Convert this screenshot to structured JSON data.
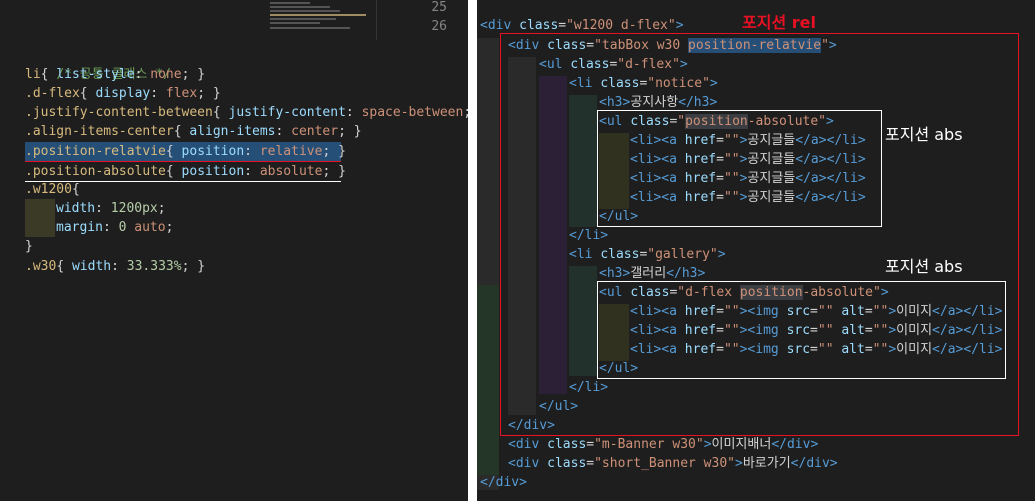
{
  "editor_left": {
    "line_numbers": [
      "25",
      "26"
    ],
    "comment": "/* 공통 클래스 */",
    "rules": [
      {
        "selector": "li",
        "property": "list-style",
        "value": "none"
      },
      {
        "selector": ".d-flex",
        "property": "display",
        "value": "flex"
      },
      {
        "selector": ".justify-content-between",
        "property": "justify-content",
        "value": "space-between"
      },
      {
        "selector": ".align-items-center",
        "property": "align-items",
        "value": "center"
      },
      {
        "selector": ".position-relatvie",
        "property": "position",
        "value": "relative"
      },
      {
        "selector": ".position-absolute",
        "property": "position",
        "value": "absolute"
      }
    ],
    "w1200": {
      "selector": ".w1200",
      "width_prop": "width",
      "width_val": "1200px",
      "margin_prop": "margin",
      "margin_val_num": "0",
      "margin_val_rest": "auto"
    },
    "w30": {
      "selector": ".w30",
      "property": "width",
      "value": "33.333%"
    }
  },
  "editor_right": {
    "div_w1200": {
      "tag": "div",
      "attr": "class",
      "value": "\"w1200 d-flex\""
    },
    "div_tabbox": {
      "tag": "div",
      "attr": "class",
      "value_prefix": "\"tabBox w30 ",
      "value_hl": "position-relatvie",
      "value_suffix": "\""
    },
    "ul_dflex": {
      "tag": "ul",
      "attr": "class",
      "value": "\"d-flex\""
    },
    "li_notice": {
      "tag": "li",
      "attr": "class",
      "value": "\"notice\""
    },
    "h3_notice": "공지사항",
    "ul_pos_abs": {
      "tag": "ul",
      "attr": "class",
      "value_prefix": "\"",
      "value_hl": "position",
      "value_suffix": "-absolute\""
    },
    "notice_item_text": "공지글들",
    "notice_items_count": 4,
    "li_gallery": {
      "tag": "li",
      "attr": "class",
      "value": "\"gallery\""
    },
    "h3_gallery": "갤러리",
    "ul_gallery": {
      "tag": "ul",
      "attr": "class",
      "value_prefix": "\"d-flex ",
      "value_hl": "position",
      "value_suffix": "-absolute\""
    },
    "gallery_item_text": "이미지",
    "div_banner": {
      "tag": "div",
      "attr": "class",
      "value": "\"m-Banner w30\"",
      "text": "이미지배너"
    },
    "div_short": {
      "tag": "div",
      "attr": "class",
      "value": "\"short_Banner w30\"",
      "text": "바로가기"
    }
  },
  "annotations": {
    "rel": "포지션 rel",
    "abs1": "포지션 abs",
    "abs2": "포지션 abs"
  },
  "colors": {
    "background": "#1e1e1e",
    "tag": "#569cd6",
    "attr": "#9cdcfe",
    "string": "#ce9178",
    "selector": "#d7ba7d",
    "comment": "#6a9955",
    "number": "#b5cea8",
    "annotation_red": "#e81123"
  }
}
